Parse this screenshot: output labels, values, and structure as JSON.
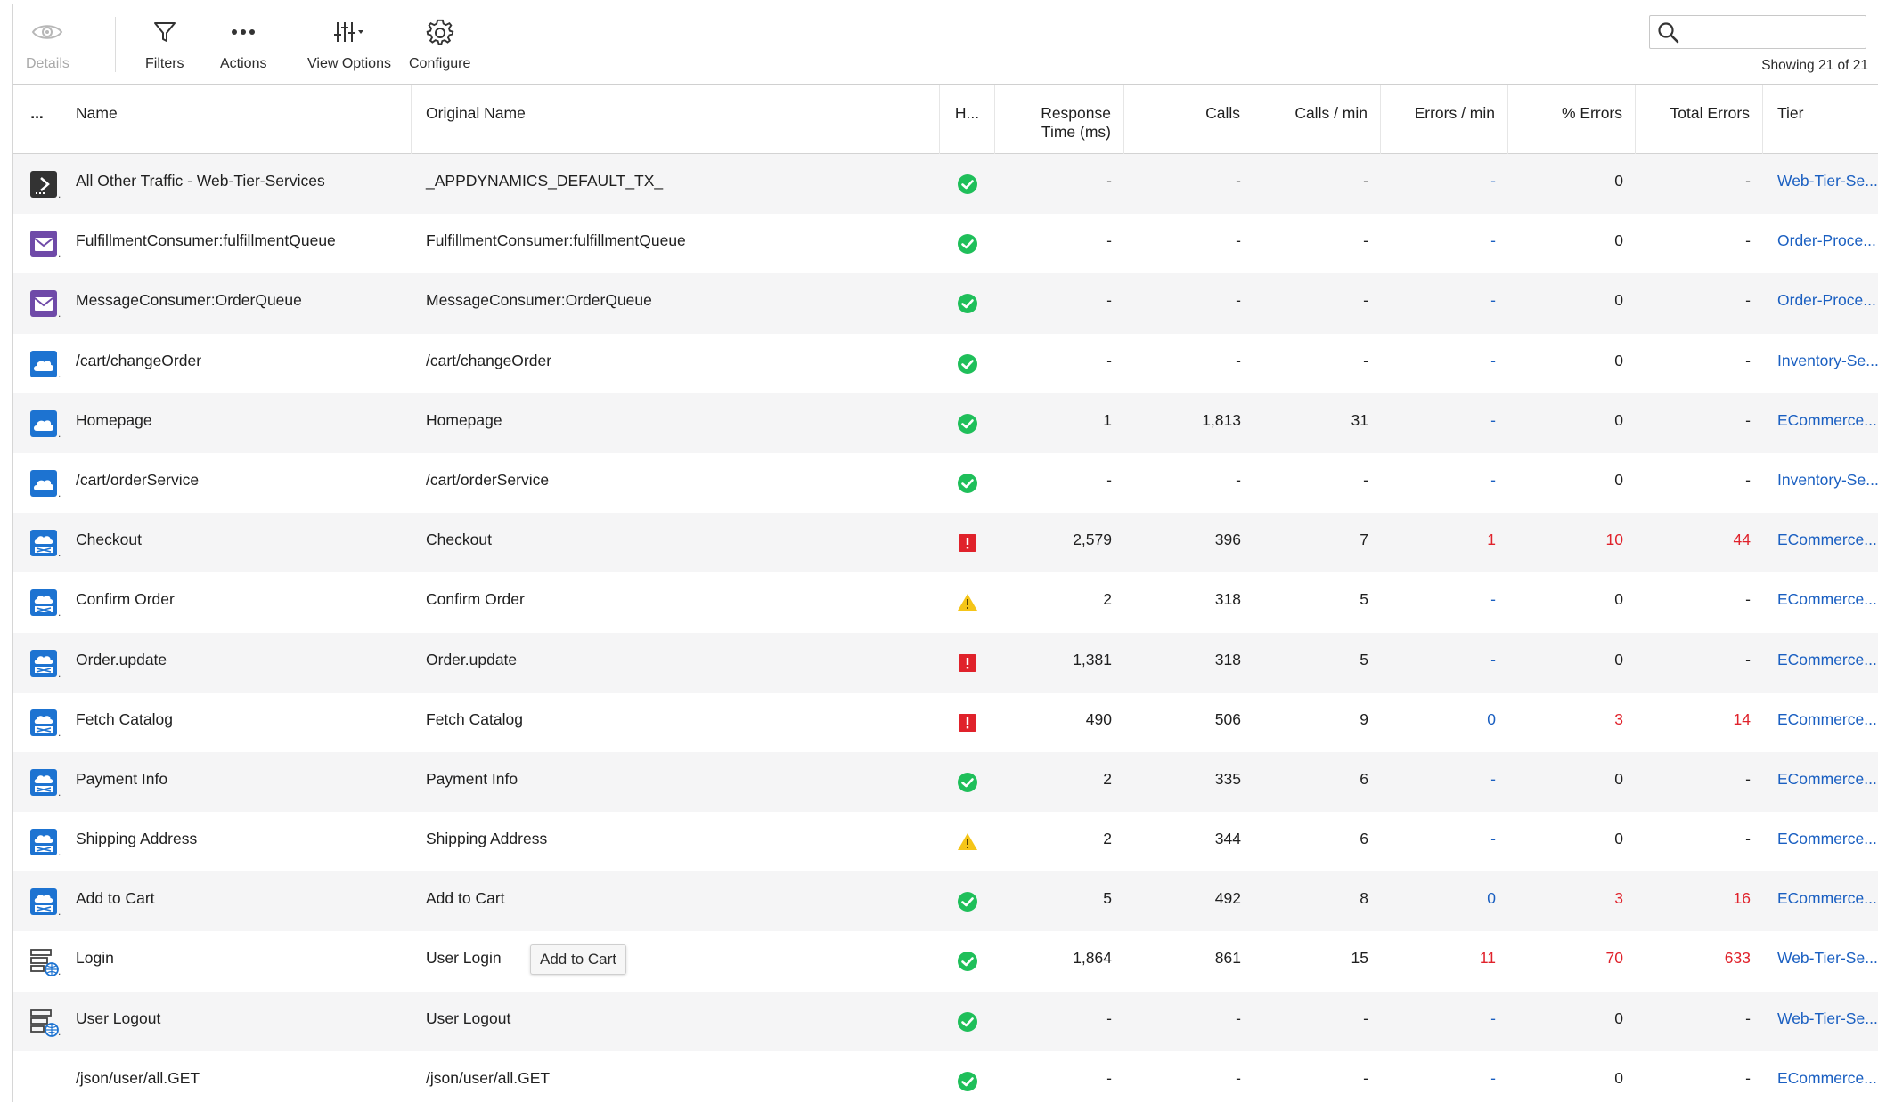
{
  "toolbar": {
    "details": {
      "label": "Details",
      "icon": "eye-icon"
    },
    "filters": {
      "label": "Filters",
      "icon": "funnel-icon"
    },
    "actions": {
      "label": "Actions",
      "icon": "more-horizontal-icon"
    },
    "view_options": {
      "label": "View Options",
      "icon": "sliders-icon"
    },
    "configure": {
      "label": "Configure",
      "icon": "gear-icon"
    }
  },
  "search": {
    "value": "",
    "placeholder": ""
  },
  "showing": "Showing 21 of 21",
  "columns": {
    "more": "...",
    "name": "Name",
    "original_name": "Original Name",
    "health": "H...",
    "response_time": "Response Time (ms)",
    "calls": "Calls",
    "calls_per_min": "Calls / min",
    "errors_per_min": "Errors / min",
    "pct_errors": "% Errors",
    "total_errors": "Total Errors",
    "tier": "Tier"
  },
  "rows": [
    {
      "type": "pojo",
      "name": "All Other Traffic - Web-Tier-Services",
      "original": "_APPDYNAMICS_DEFAULT_TX_",
      "health": "normal",
      "rt": "-",
      "calls": "-",
      "cpm": "-",
      "epm": "-",
      "pct": "0",
      "total": "-",
      "tier": "Web-Tier-Se..."
    },
    {
      "type": "message",
      "name": "FulfillmentConsumer:fulfillmentQueue",
      "original": "FulfillmentConsumer:fulfillmentQueue",
      "health": "normal",
      "rt": "-",
      "calls": "-",
      "cpm": "-",
      "epm": "-",
      "pct": "0",
      "total": "-",
      "tier": "Order-Proce..."
    },
    {
      "type": "message",
      "name": "MessageConsumer:OrderQueue",
      "original": "MessageConsumer:OrderQueue",
      "health": "normal",
      "rt": "-",
      "calls": "-",
      "cpm": "-",
      "epm": "-",
      "pct": "0",
      "total": "-",
      "tier": "Order-Proce..."
    },
    {
      "type": "cloud",
      "name": "/cart/changeOrder",
      "original": "/cart/changeOrder",
      "health": "normal",
      "rt": "-",
      "calls": "-",
      "cpm": "-",
      "epm": "-",
      "pct": "0",
      "total": "-",
      "tier": "Inventory-Se..."
    },
    {
      "type": "cloud",
      "name": "Homepage",
      "original": "Homepage",
      "health": "normal",
      "rt": "1",
      "calls": "1,813",
      "cpm": "31",
      "epm": "-",
      "pct": "0",
      "total": "-",
      "tier": "ECommerce..."
    },
    {
      "type": "cloud",
      "name": "/cart/orderService",
      "original": "/cart/orderService",
      "health": "normal",
      "rt": "-",
      "calls": "-",
      "cpm": "-",
      "epm": "-",
      "pct": "0",
      "total": "-",
      "tier": "Inventory-Se..."
    },
    {
      "type": "web",
      "name": "Checkout",
      "original": "Checkout",
      "health": "critical",
      "rt": "2,579",
      "calls": "396",
      "cpm": "7",
      "epm": "1",
      "pct": "10",
      "total": "44",
      "tier": "ECommerce...",
      "err": true
    },
    {
      "type": "web",
      "name": "Confirm Order",
      "original": "Confirm Order",
      "health": "warning",
      "rt": "2",
      "calls": "318",
      "cpm": "5",
      "epm": "-",
      "pct": "0",
      "total": "-",
      "tier": "ECommerce..."
    },
    {
      "type": "web",
      "name": "Order.update",
      "original": "Order.update",
      "health": "critical",
      "rt": "1,381",
      "calls": "318",
      "cpm": "5",
      "epm": "-",
      "pct": "0",
      "total": "-",
      "tier": "ECommerce..."
    },
    {
      "type": "web",
      "name": "Fetch Catalog",
      "original": "Fetch Catalog",
      "health": "critical",
      "rt": "490",
      "calls": "506",
      "cpm": "9",
      "epm": "0",
      "pct": "3",
      "total": "14",
      "tier": "ECommerce...",
      "err": true,
      "epm_blue": true
    },
    {
      "type": "web",
      "name": "Payment Info",
      "original": "Payment Info",
      "health": "normal",
      "rt": "2",
      "calls": "335",
      "cpm": "6",
      "epm": "-",
      "pct": "0",
      "total": "-",
      "tier": "ECommerce..."
    },
    {
      "type": "web",
      "name": "Shipping Address",
      "original": "Shipping Address",
      "health": "warning",
      "rt": "2",
      "calls": "344",
      "cpm": "6",
      "epm": "-",
      "pct": "0",
      "total": "-",
      "tier": "ECommerce..."
    },
    {
      "type": "web",
      "name": "Add to Cart",
      "original": "Add to Cart",
      "health": "normal",
      "rt": "5",
      "calls": "492",
      "cpm": "8",
      "epm": "0",
      "pct": "3",
      "total": "16",
      "tier": "ECommerce...",
      "err": true,
      "epm_blue": true
    },
    {
      "type": "service",
      "name": "Login",
      "original": "User Login",
      "health": "normal",
      "rt": "1,864",
      "calls": "861",
      "cpm": "15",
      "epm": "11",
      "pct": "70",
      "total": "633",
      "tier": "Web-Tier-Se...",
      "err": true
    },
    {
      "type": "service",
      "name": "User Logout",
      "original": "User Logout",
      "health": "normal",
      "rt": "-",
      "calls": "-",
      "cpm": "-",
      "epm": "-",
      "pct": "0",
      "total": "-",
      "tier": "Web-Tier-Se..."
    },
    {
      "type": "none",
      "name": "/json/user/all.GET",
      "original": "/json/user/all.GET",
      "health": "normal",
      "rt": "-",
      "calls": "-",
      "cpm": "-",
      "epm": "-",
      "pct": "0",
      "total": "-",
      "tier": "ECommerce..."
    }
  ],
  "tooltip": "Add to Cart",
  "colors": {
    "link": "#1a5fc1",
    "error": "#e0222b",
    "ok": "#1fbf5a",
    "warn": "#f5c518",
    "crit": "#e0222b"
  }
}
